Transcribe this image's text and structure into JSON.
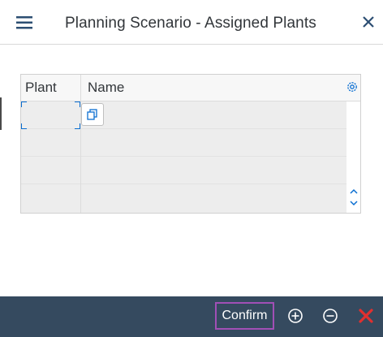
{
  "dialog": {
    "title": "Planning Scenario - Assigned Plants",
    "menu_icon": "hamburger-icon",
    "close_icon": "close-icon"
  },
  "table": {
    "columns": [
      "Plant",
      "Name"
    ],
    "settings_icon": "gear-icon",
    "rows": [
      {
        "plant": "",
        "name": ""
      },
      {
        "plant": "",
        "name": ""
      },
      {
        "plant": "",
        "name": ""
      },
      {
        "plant": "",
        "name": ""
      }
    ],
    "value_help_icon": "value-help-icon",
    "scroll_up_icon": "chevron-up-icon",
    "scroll_down_icon": "chevron-down-icon"
  },
  "footer": {
    "confirm_label": "Confirm",
    "add_icon": "plus-circle-icon",
    "remove_icon": "minus-circle-icon",
    "cancel_icon": "red-x-icon"
  },
  "colors": {
    "accent": "#0a6ed1",
    "footer_bg": "#354a5f",
    "confirm_outline": "#a14fb6",
    "cancel_red": "#e0302f",
    "title_text": "#32363a",
    "grid_bg": "#ededed"
  }
}
